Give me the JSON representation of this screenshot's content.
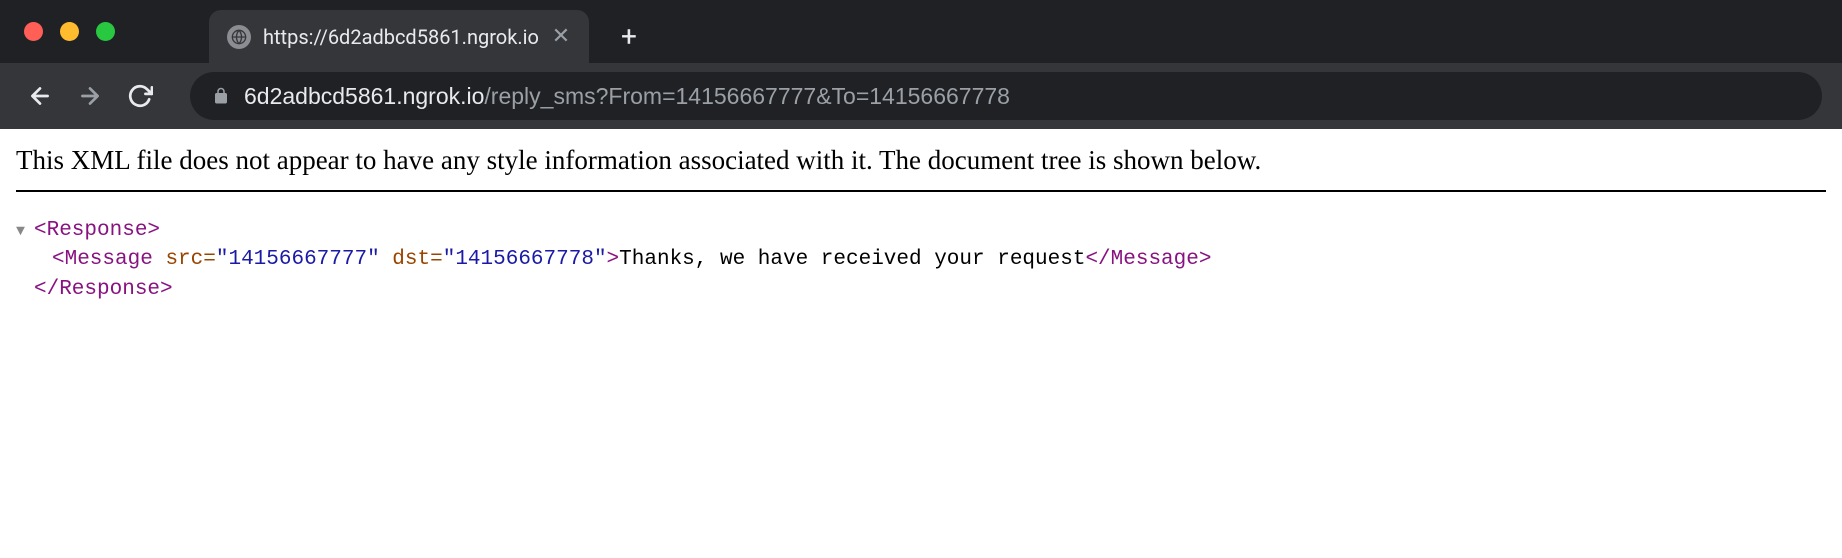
{
  "tab": {
    "title": "https://6d2adbcd5861.ngrok.io"
  },
  "url": {
    "domain": "6d2adbcd5861.ngrok.io",
    "path": "/reply_sms?From=14156667777&To=14156667778"
  },
  "xml_notice": "This XML file does not appear to have any style information associated with it. The document tree is shown below.",
  "xml": {
    "root_open": "<Response>",
    "root_close": "</Response>",
    "msg_tag_open": "<Message",
    "msg_attr1_name": "src=",
    "msg_attr1_value": "\"14156667777\"",
    "msg_attr2_name": "dst=",
    "msg_attr2_value": "\"14156667778\"",
    "msg_close_bracket": ">",
    "msg_text": "Thanks, we have received your request",
    "msg_tag_close": "</Message>"
  }
}
